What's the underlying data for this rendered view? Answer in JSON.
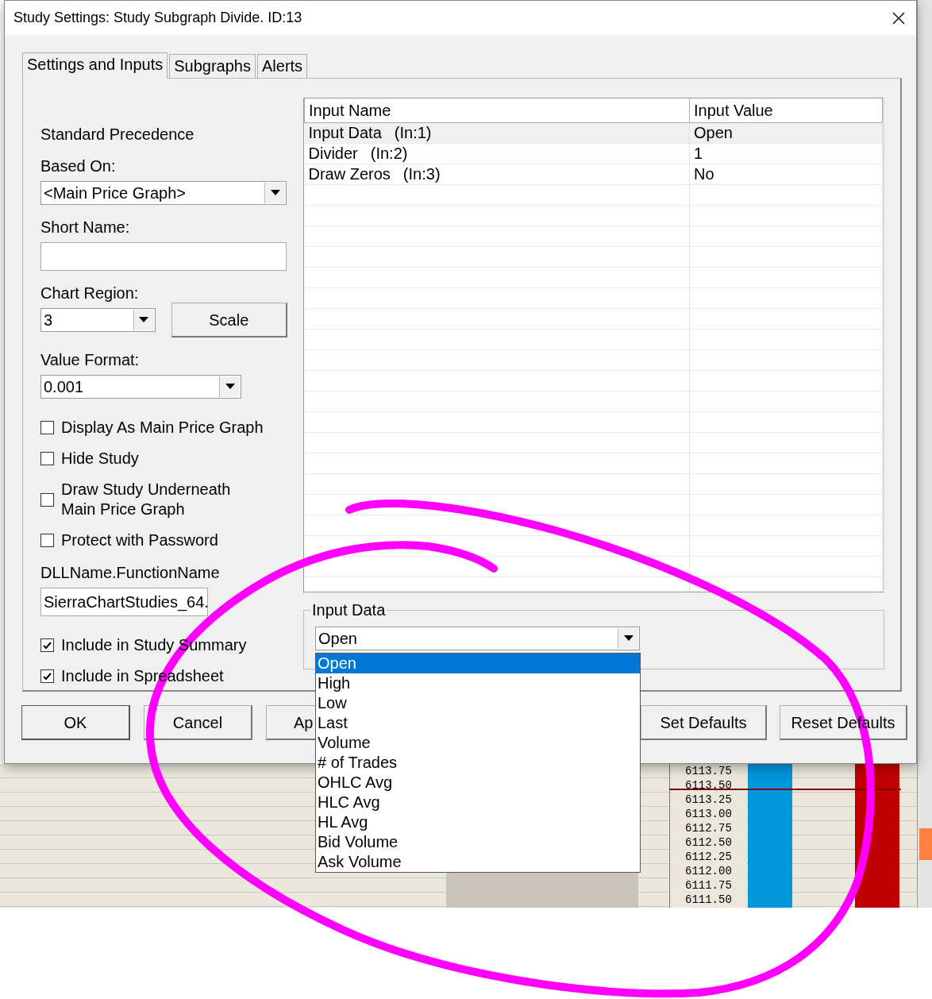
{
  "window": {
    "title": "Study Settings: Study Subgraph Divide. ID:13"
  },
  "tabs": [
    {
      "label": "Settings and Inputs",
      "selected": true
    },
    {
      "label": "Subgraphs",
      "selected": false
    },
    {
      "label": "Alerts",
      "selected": false
    }
  ],
  "settings": [
    {
      "kind": "heading",
      "text": "Standard Precedence"
    },
    {
      "kind": "select",
      "label": "Based On:",
      "value": "<Main Price Graph>"
    },
    {
      "kind": "text",
      "label": "Short Name:"
    },
    {
      "kind": "select_button",
      "label": "Chart Region:",
      "value": "3",
      "button": "Scale"
    },
    {
      "kind": "select_medium",
      "label": "Value Format:",
      "value": "0.001"
    },
    {
      "kind": "checkbox",
      "label": "Display As Main Price Graph",
      "checked": false
    },
    {
      "kind": "checkbox",
      "label": "Hide Study",
      "checked": false
    },
    {
      "kind": "checkbox",
      "label": "Draw Study Underneath\nMain Price Graph",
      "checked": false
    },
    {
      "kind": "checkbox",
      "label": "Protect with Password",
      "checked": false
    },
    {
      "kind": "text_narrow",
      "label": "DLLName.FunctionName",
      "value": "SierraChartStudies_64."
    },
    {
      "kind": "checkbox",
      "label": "Include in Study Summary",
      "checked": true
    },
    {
      "kind": "checkbox",
      "label": "Include in Spreadsheet",
      "checked": true
    }
  ],
  "inputs_table": {
    "columns": [
      "Input Name",
      "Input Value"
    ],
    "rows": [
      {
        "name": "Input Data",
        "ref": "(In:1)",
        "value": "Open",
        "selected": true
      },
      {
        "name": "Divider",
        "ref": "(In:2)",
        "value": "1",
        "selected": false
      },
      {
        "name": "Draw Zeros",
        "ref": "(In:3)",
        "value": "No",
        "selected": false
      }
    ]
  },
  "input_group": {
    "title": "Input Data",
    "value": "Open",
    "options": [
      {
        "label": "Open",
        "selected": true
      },
      {
        "label": "High",
        "selected": false
      },
      {
        "label": "Low",
        "selected": false
      },
      {
        "label": "Last",
        "selected": false
      },
      {
        "label": "Volume",
        "selected": false
      },
      {
        "label": "# of Trades",
        "selected": false
      },
      {
        "label": "OHLC Avg",
        "selected": false
      },
      {
        "label": "HLC Avg",
        "selected": false
      },
      {
        "label": "HL Avg",
        "selected": false
      },
      {
        "label": "Bid Volume",
        "selected": false
      },
      {
        "label": "Ask Volume",
        "selected": false
      }
    ]
  },
  "buttons": [
    "OK",
    "Cancel",
    "Ap",
    "Set Defaults",
    "Reset Defaults"
  ],
  "chart": {
    "price_labels": [
      "6113.75",
      "6113.50",
      "6113.25",
      "6113.00",
      "6112.75",
      "6112.50",
      "6112.25",
      "6112.00",
      "6111.75",
      "6111.50"
    ]
  }
}
